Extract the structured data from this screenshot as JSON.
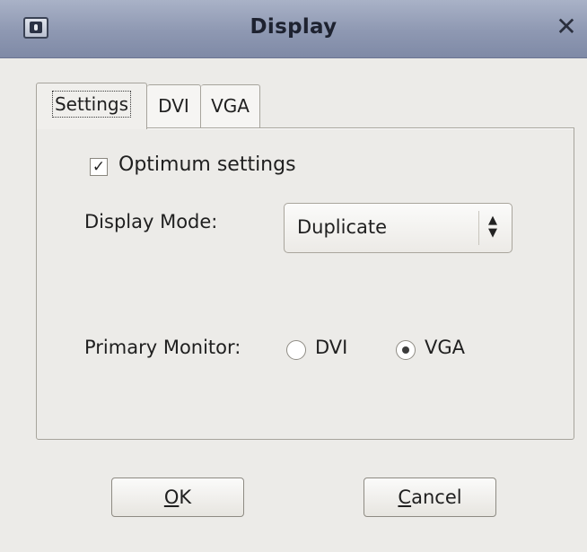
{
  "window": {
    "title": "Display",
    "app_icon": "display-settings-icon",
    "close_icon": "close-icon",
    "close_glyph": "✕"
  },
  "tabs": [
    {
      "label": "Settings",
      "active": true
    },
    {
      "label": "DVI",
      "active": false
    },
    {
      "label": "VGA",
      "active": false
    }
  ],
  "settings": {
    "optimum_checkbox": {
      "label": "Optimum settings",
      "checked": true,
      "glyph": "✓"
    },
    "display_mode": {
      "label": "Display Mode:",
      "value": "Duplicate",
      "glyph": "⬍"
    },
    "primary_monitor": {
      "label": "Primary Monitor:",
      "options": [
        {
          "label": "DVI",
          "selected": false
        },
        {
          "label": "VGA",
          "selected": true
        }
      ]
    }
  },
  "buttons": {
    "ok": {
      "mnemonic": "O",
      "rest": "K"
    },
    "cancel": {
      "mnemonic": "C",
      "rest": "ancel"
    }
  }
}
